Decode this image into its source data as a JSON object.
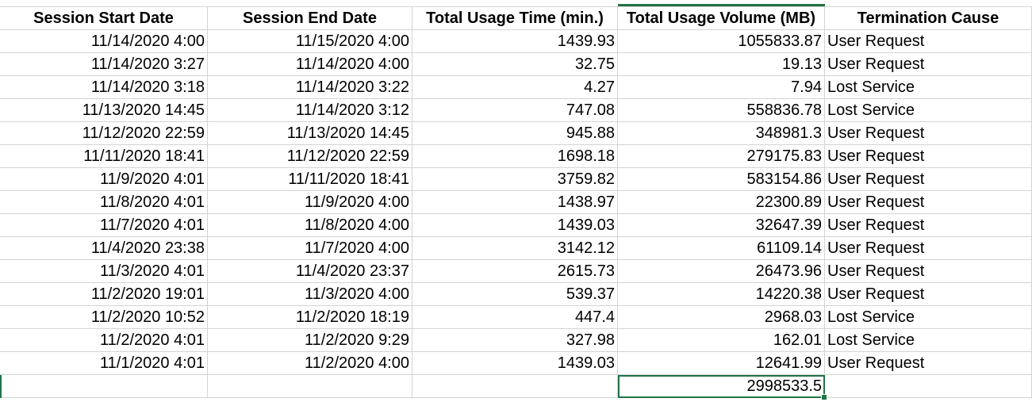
{
  "headers": [
    "Session Start Date",
    "Session End Date",
    "Total Usage Time (min.)",
    "Total Usage Volume (MB)",
    "Termination Cause"
  ],
  "rows": [
    [
      "11/14/2020 4:00",
      "11/15/2020 4:00",
      "1439.93",
      "1055833.87",
      "User Request"
    ],
    [
      "11/14/2020 3:27",
      "11/14/2020 4:00",
      "32.75",
      "19.13",
      "User Request"
    ],
    [
      "11/14/2020 3:18",
      "11/14/2020 3:22",
      "4.27",
      "7.94",
      "Lost Service"
    ],
    [
      "11/13/2020 14:45",
      "11/14/2020 3:12",
      "747.08",
      "558836.78",
      "Lost Service"
    ],
    [
      "11/12/2020 22:59",
      "11/13/2020 14:45",
      "945.88",
      "348981.3",
      "User Request"
    ],
    [
      "11/11/2020 18:41",
      "11/12/2020 22:59",
      "1698.18",
      "279175.83",
      "User Request"
    ],
    [
      "11/9/2020 4:01",
      "11/11/2020 18:41",
      "3759.82",
      "583154.86",
      "User Request"
    ],
    [
      "11/8/2020 4:01",
      "11/9/2020 4:00",
      "1438.97",
      "22300.89",
      "User Request"
    ],
    [
      "11/7/2020 4:01",
      "11/8/2020 4:00",
      "1439.03",
      "32647.39",
      "User Request"
    ],
    [
      "11/4/2020 23:38",
      "11/7/2020 4:00",
      "3142.12",
      "61109.14",
      "User Request"
    ],
    [
      "11/3/2020 4:01",
      "11/4/2020 23:37",
      "2615.73",
      "26473.96",
      "User Request"
    ],
    [
      "11/2/2020 19:01",
      "11/3/2020 4:00",
      "539.37",
      "14220.38",
      "User Request"
    ],
    [
      "11/2/2020 10:52",
      "11/2/2020 18:19",
      "447.4",
      "2968.03",
      "Lost Service"
    ],
    [
      "11/2/2020 4:01",
      "11/2/2020 9:29",
      "327.98",
      "162.01",
      "Lost Service"
    ],
    [
      "11/1/2020 4:01",
      "11/2/2020 4:00",
      "1439.03",
      "12641.99",
      "User Request"
    ]
  ],
  "total_row": [
    "",
    "",
    "",
    "2998533.5",
    ""
  ],
  "colors": {
    "gridline": "#d4d4d4",
    "selection": "#217346"
  }
}
